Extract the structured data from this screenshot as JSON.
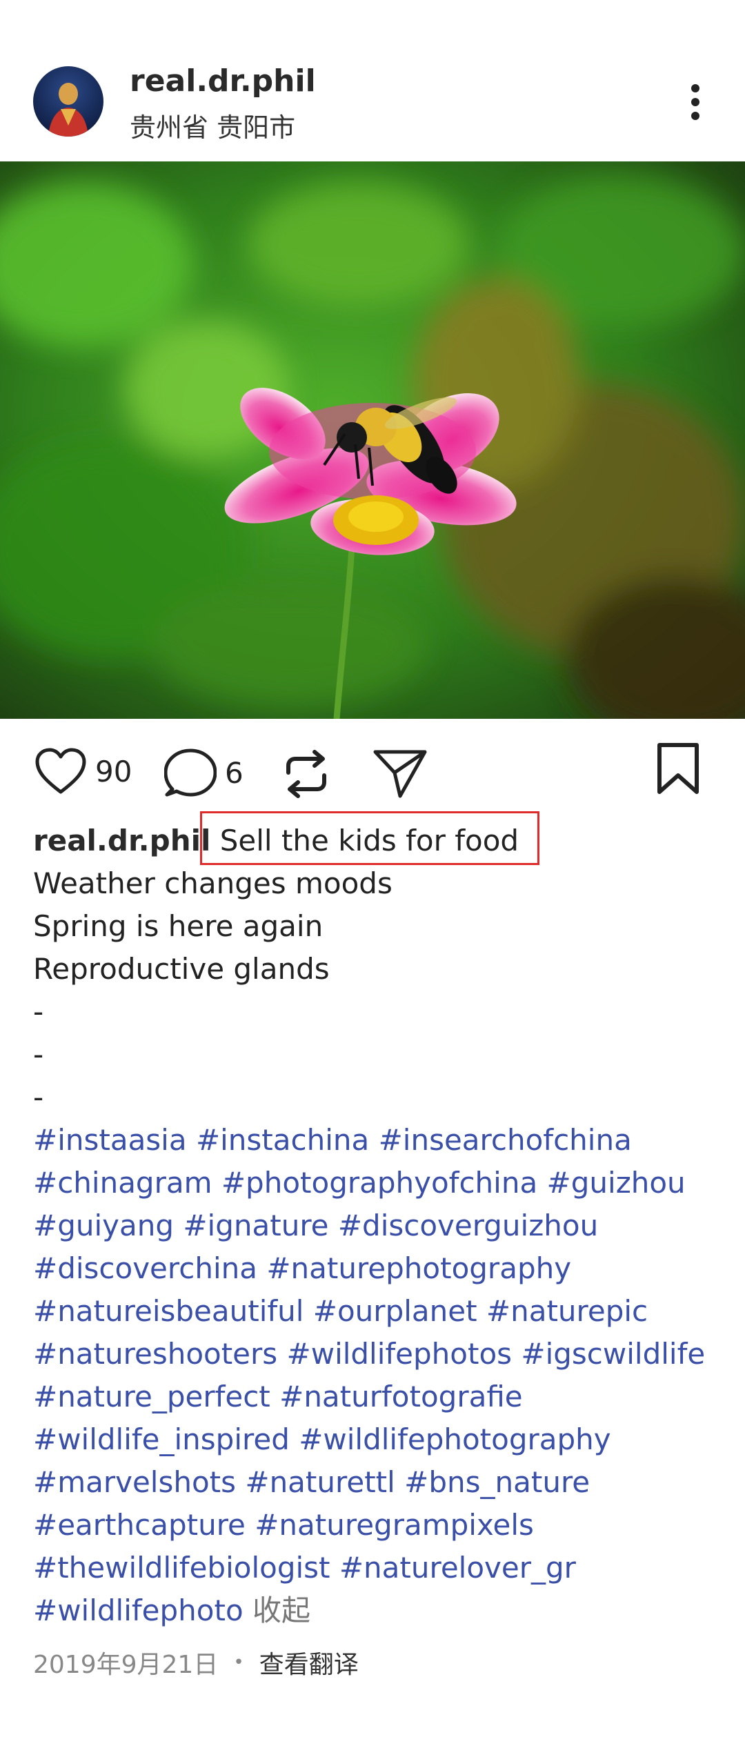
{
  "header": {
    "username": "real.dr.phil",
    "location": "贵州省 贵阳市"
  },
  "icons": {
    "more": "more-vertical-icon",
    "like": "heart-icon",
    "comment": "comment-icon",
    "repost": "repost-icon",
    "share": "send-icon",
    "save": "bookmark-icon"
  },
  "actions": {
    "like_count": "90",
    "comment_count": "6"
  },
  "caption": {
    "username": "real.dr.phil",
    "lines": [
      "Sell the kids for food",
      "Weather changes moods",
      "Spring is here again",
      "Reproductive glands",
      "-",
      "-",
      "-"
    ],
    "hashtag_lines": [
      "#instaasia #instachina #insearchofchina",
      "#chinagram #photographyofchina #guizhou",
      "#guiyang #ignature #discoverguizhou",
      "#discoverchina #naturephotography",
      "#natureisbeautiful #ourplanet #naturepic",
      "#natureshooters #wildlifephotos #igscwildlife",
      "#nature_perfect #naturfotografie",
      "#wildlife_inspired #wildlifephotography",
      "#marvelshots #naturettl #bns_nature",
      "#earthcapture #naturegrampixels",
      "#thewildlifebiologist #naturelover_gr",
      "#wildlifephoto"
    ],
    "collapse_label": "收起"
  },
  "meta": {
    "date": "2019年9月21日",
    "separator": "•",
    "translate_label": "查看翻译"
  },
  "colors": {
    "hashtag": "#3a4fa8",
    "highlight_box": "#e02a2a"
  }
}
